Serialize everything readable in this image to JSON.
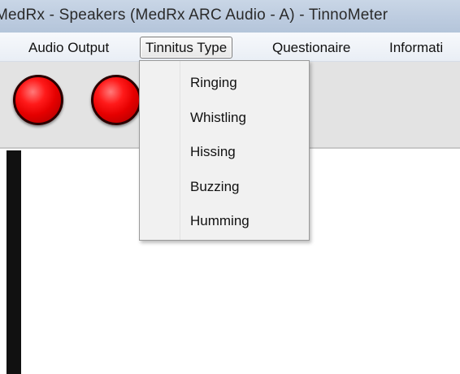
{
  "window": {
    "title": "MedRx - Speakers (MedRx ARC Audio - A) - TinnoMeter"
  },
  "menubar": {
    "items": [
      {
        "label": "Audio Output"
      },
      {
        "label": "Tinnitus Type"
      },
      {
        "label": "Questionaire"
      },
      {
        "label": "Informati"
      }
    ]
  },
  "tinnitus_menu": {
    "options": [
      {
        "label": "Ringing"
      },
      {
        "label": "Whistling"
      },
      {
        "label": "Hissing"
      },
      {
        "label": "Buzzing"
      },
      {
        "label": "Humming"
      }
    ]
  },
  "toolbar": {
    "indicators": [
      {
        "color": "#ff1a1a"
      },
      {
        "color": "#ff1a1a"
      }
    ]
  },
  "colors": {
    "titlebar": "#bccbdf",
    "menubar": "#eef2f7",
    "toolbar": "#e3e3e3",
    "led_red": "#ff1a1a",
    "dropdown": "#f1f1f1"
  }
}
